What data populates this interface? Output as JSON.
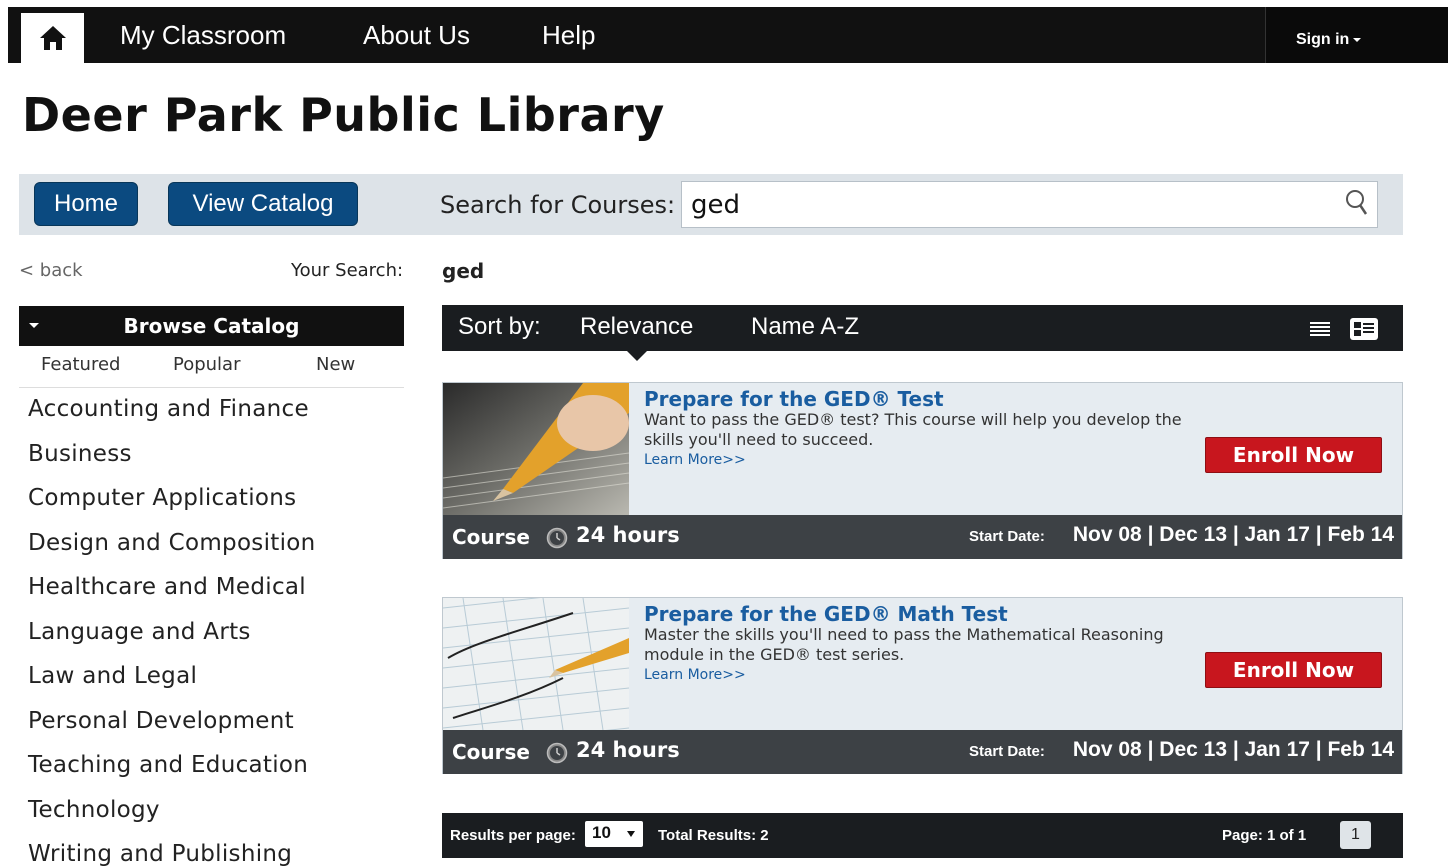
{
  "nav": {
    "links": [
      "My Classroom",
      "About Us",
      "Help"
    ],
    "sign_in": "Sign in"
  },
  "site_title": "Deer Park Public Library",
  "toolbar": {
    "home_label": "Home",
    "catalog_label": "View Catalog",
    "search_label": "Search for Courses:",
    "search_value": "ged"
  },
  "sidebar": {
    "back_label": "< back",
    "your_search_label": "Your Search:",
    "browse_title": "Browse Catalog",
    "tabs": [
      "Featured",
      "Popular",
      "New"
    ],
    "categories": [
      "Accounting and Finance",
      "Business",
      "Computer Applications",
      "Design and Composition",
      "Healthcare and Medical",
      "Language and Arts",
      "Law and Legal",
      "Personal Development",
      "Teaching and Education",
      "Technology",
      "Writing and Publishing"
    ]
  },
  "results": {
    "query": "ged",
    "sort_label": "Sort by:",
    "sort_options": [
      "Relevance",
      "Name A-Z"
    ],
    "courses": [
      {
        "title": "Prepare for the GED® Test",
        "description": "Want to pass the GED® test? This course will help you develop the skills you'll need to succeed.",
        "learn_more": "Learn More>>",
        "enroll": "Enroll Now",
        "type": "Course",
        "duration": "24 hours",
        "start_label": "Start Date:",
        "dates": "Nov 08 | Dec 13 | Jan 17 | Feb 14"
      },
      {
        "title": "Prepare for the GED® Math Test",
        "description": "Master the skills you'll need to pass the Mathematical Reasoning module in the GED® test series.",
        "learn_more": "Learn More>>",
        "enroll": "Enroll Now",
        "type": "Course",
        "duration": "24 hours",
        "start_label": "Start Date:",
        "dates": "Nov 08 | Dec 13 | Jan 17 | Feb 14"
      }
    ]
  },
  "pager": {
    "rpp_label": "Results per page:",
    "rpp_value": "10",
    "total": "Total Results: 2",
    "page_of": "Page: 1 of 1",
    "current_page": "1"
  },
  "colors": {
    "nav_bg": "#111111",
    "button_blue": "#0b4a80",
    "enroll_red": "#c8161e",
    "link_blue": "#1a5da0"
  }
}
